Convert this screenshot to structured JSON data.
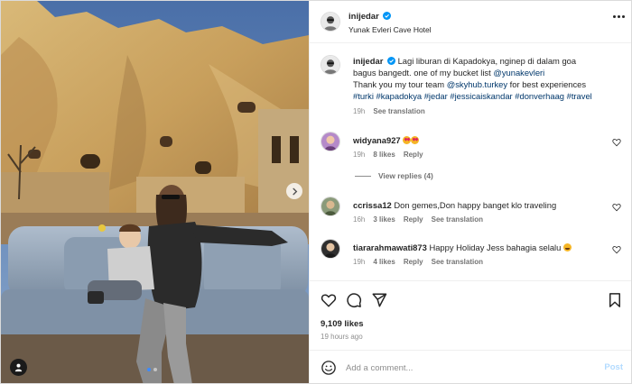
{
  "post": {
    "username": "inijedar",
    "location": "Yunak Evleri Cave Hotel",
    "caption_line1": "Lagi liburan di Kapadokya, nginep di dalam goa",
    "caption_line2a": "bagus bangedt. one of my bucket list ",
    "caption_mention1": "@yunakevleri",
    "caption_line3a": "Thank you my tour team ",
    "caption_mention2": "@skyhub.turkey",
    "caption_line3b": " for best experiences",
    "caption_hashtags": "#turki #kapadokya #jedar #jessicaiskandar #donverhaag #travel",
    "caption_time": "19h",
    "see_translation": "See translation",
    "likes": "9,109 likes",
    "time_ago": "19 hours ago"
  },
  "comments": [
    {
      "username": "widyana927",
      "text": "",
      "time": "19h",
      "likes": "8 likes",
      "reply": "Reply",
      "see_translation": ""
    },
    {
      "username": "ccrissa12",
      "text": "Don gemes,Don happy banget klo traveling",
      "time": "16h",
      "likes": "3 likes",
      "reply": "Reply",
      "see_translation": "See translation"
    },
    {
      "username": "tiararahmawati873",
      "text": "Happy Holiday Jess bahagia selalu",
      "time": "19h",
      "likes": "4 likes",
      "reply": "Reply",
      "see_translation": "See translation"
    }
  ],
  "view_replies": "View replies (4)",
  "composer": {
    "placeholder": "Add a comment...",
    "post_label": "Post"
  },
  "icons": {
    "like": "heart-icon",
    "comment": "comment-icon",
    "share": "paper-plane-icon",
    "save": "bookmark-icon",
    "emoji": "smiley-icon",
    "more": "more-dots-icon",
    "verified": "verified-badge-icon",
    "tag": "person-tag-icon",
    "next": "chevron-right-icon"
  },
  "colors": {
    "verified": "#0095f6",
    "link": "#00376b",
    "post_disabled": "#b3dbff",
    "carousel_active": "#3d8bfd"
  },
  "carousel": {
    "count": 2,
    "active": 1
  }
}
